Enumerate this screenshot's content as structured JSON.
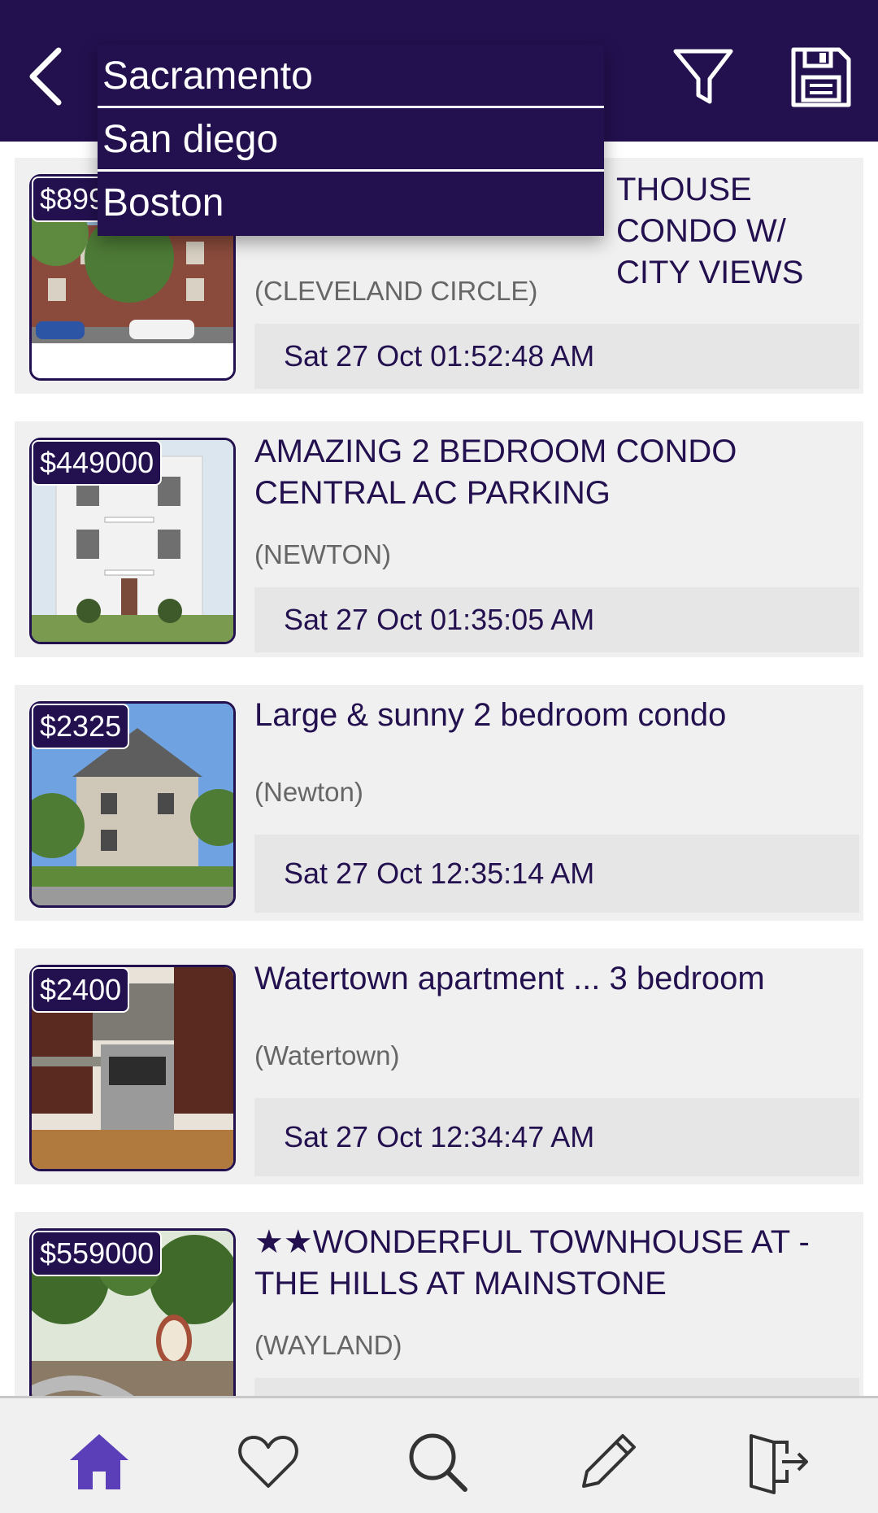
{
  "header": {
    "search_value": "Sacramento",
    "suggestions": [
      "San diego",
      "Boston"
    ],
    "icons": {
      "back": "chevron-left-icon",
      "filter": "filter-icon",
      "save": "floppy-save-icon"
    }
  },
  "listings": [
    {
      "price": "$899",
      "title": "THOUSE CONDO W/ CITY VIEWS",
      "location": "(CLEVELAND CIRCLE)",
      "date": "Sat 27 Oct 01:52:48 AM"
    },
    {
      "price": "$449000",
      "title": "AMAZING 2 BEDROOM CONDO CENTRAL AC PARKING",
      "location": "(NEWTON)",
      "date": "Sat 27 Oct 01:35:05 AM"
    },
    {
      "price": "$2325",
      "title": "Large & sunny 2 bedroom condo",
      "location": "(Newton)",
      "date": "Sat 27 Oct 12:35:14 AM"
    },
    {
      "price": "$2400",
      "title": "Watertown apartment ... 3 bedroom",
      "location": "(Watertown)",
      "date": "Sat 27 Oct 12:34:47 AM"
    },
    {
      "price": "$559000",
      "title": "★★WONDERFUL TOWNHOUSE AT - THE HILLS AT MAINSTONE",
      "location": "(WAYLAND)",
      "date": ""
    }
  ],
  "bottom_nav": {
    "items": [
      "home-icon",
      "heart-icon",
      "search-icon",
      "pencil-icon",
      "exit-icon"
    ],
    "active": "home-icon"
  },
  "colors": {
    "primary": "#23104f",
    "active_nav": "#5b3fb8",
    "card_bg": "#f0f0f0",
    "date_bg": "#e6e6e6"
  }
}
